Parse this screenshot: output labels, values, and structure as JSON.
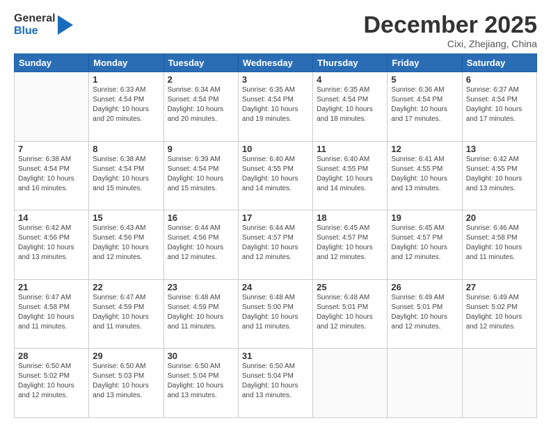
{
  "header": {
    "logo_general": "General",
    "logo_blue": "Blue",
    "month_title": "December 2025",
    "location": "Cixi, Zhejiang, China"
  },
  "weekdays": [
    "Sunday",
    "Monday",
    "Tuesday",
    "Wednesday",
    "Thursday",
    "Friday",
    "Saturday"
  ],
  "weeks": [
    [
      {
        "day": "",
        "info": ""
      },
      {
        "day": "1",
        "info": "Sunrise: 6:33 AM\nSunset: 4:54 PM\nDaylight: 10 hours\nand 20 minutes."
      },
      {
        "day": "2",
        "info": "Sunrise: 6:34 AM\nSunset: 4:54 PM\nDaylight: 10 hours\nand 20 minutes."
      },
      {
        "day": "3",
        "info": "Sunrise: 6:35 AM\nSunset: 4:54 PM\nDaylight: 10 hours\nand 19 minutes."
      },
      {
        "day": "4",
        "info": "Sunrise: 6:35 AM\nSunset: 4:54 PM\nDaylight: 10 hours\nand 18 minutes."
      },
      {
        "day": "5",
        "info": "Sunrise: 6:36 AM\nSunset: 4:54 PM\nDaylight: 10 hours\nand 17 minutes."
      },
      {
        "day": "6",
        "info": "Sunrise: 6:37 AM\nSunset: 4:54 PM\nDaylight: 10 hours\nand 17 minutes."
      }
    ],
    [
      {
        "day": "7",
        "info": "Sunrise: 6:38 AM\nSunset: 4:54 PM\nDaylight: 10 hours\nand 16 minutes."
      },
      {
        "day": "8",
        "info": "Sunrise: 6:38 AM\nSunset: 4:54 PM\nDaylight: 10 hours\nand 15 minutes."
      },
      {
        "day": "9",
        "info": "Sunrise: 6:39 AM\nSunset: 4:54 PM\nDaylight: 10 hours\nand 15 minutes."
      },
      {
        "day": "10",
        "info": "Sunrise: 6:40 AM\nSunset: 4:55 PM\nDaylight: 10 hours\nand 14 minutes."
      },
      {
        "day": "11",
        "info": "Sunrise: 6:40 AM\nSunset: 4:55 PM\nDaylight: 10 hours\nand 14 minutes."
      },
      {
        "day": "12",
        "info": "Sunrise: 6:41 AM\nSunset: 4:55 PM\nDaylight: 10 hours\nand 13 minutes."
      },
      {
        "day": "13",
        "info": "Sunrise: 6:42 AM\nSunset: 4:55 PM\nDaylight: 10 hours\nand 13 minutes."
      }
    ],
    [
      {
        "day": "14",
        "info": "Sunrise: 6:42 AM\nSunset: 4:56 PM\nDaylight: 10 hours\nand 13 minutes."
      },
      {
        "day": "15",
        "info": "Sunrise: 6:43 AM\nSunset: 4:56 PM\nDaylight: 10 hours\nand 12 minutes."
      },
      {
        "day": "16",
        "info": "Sunrise: 6:44 AM\nSunset: 4:56 PM\nDaylight: 10 hours\nand 12 minutes."
      },
      {
        "day": "17",
        "info": "Sunrise: 6:44 AM\nSunset: 4:57 PM\nDaylight: 10 hours\nand 12 minutes."
      },
      {
        "day": "18",
        "info": "Sunrise: 6:45 AM\nSunset: 4:57 PM\nDaylight: 10 hours\nand 12 minutes."
      },
      {
        "day": "19",
        "info": "Sunrise: 6:45 AM\nSunset: 4:57 PM\nDaylight: 10 hours\nand 12 minutes."
      },
      {
        "day": "20",
        "info": "Sunrise: 6:46 AM\nSunset: 4:58 PM\nDaylight: 10 hours\nand 11 minutes."
      }
    ],
    [
      {
        "day": "21",
        "info": "Sunrise: 6:47 AM\nSunset: 4:58 PM\nDaylight: 10 hours\nand 11 minutes."
      },
      {
        "day": "22",
        "info": "Sunrise: 6:47 AM\nSunset: 4:59 PM\nDaylight: 10 hours\nand 11 minutes."
      },
      {
        "day": "23",
        "info": "Sunrise: 6:48 AM\nSunset: 4:59 PM\nDaylight: 10 hours\nand 11 minutes."
      },
      {
        "day": "24",
        "info": "Sunrise: 6:48 AM\nSunset: 5:00 PM\nDaylight: 10 hours\nand 11 minutes."
      },
      {
        "day": "25",
        "info": "Sunrise: 6:48 AM\nSunset: 5:01 PM\nDaylight: 10 hours\nand 12 minutes."
      },
      {
        "day": "26",
        "info": "Sunrise: 6:49 AM\nSunset: 5:01 PM\nDaylight: 10 hours\nand 12 minutes."
      },
      {
        "day": "27",
        "info": "Sunrise: 6:49 AM\nSunset: 5:02 PM\nDaylight: 10 hours\nand 12 minutes."
      }
    ],
    [
      {
        "day": "28",
        "info": "Sunrise: 6:50 AM\nSunset: 5:02 PM\nDaylight: 10 hours\nand 12 minutes."
      },
      {
        "day": "29",
        "info": "Sunrise: 6:50 AM\nSunset: 5:03 PM\nDaylight: 10 hours\nand 13 minutes."
      },
      {
        "day": "30",
        "info": "Sunrise: 6:50 AM\nSunset: 5:04 PM\nDaylight: 10 hours\nand 13 minutes."
      },
      {
        "day": "31",
        "info": "Sunrise: 6:50 AM\nSunset: 5:04 PM\nDaylight: 10 hours\nand 13 minutes."
      },
      {
        "day": "",
        "info": ""
      },
      {
        "day": "",
        "info": ""
      },
      {
        "day": "",
        "info": ""
      }
    ]
  ]
}
